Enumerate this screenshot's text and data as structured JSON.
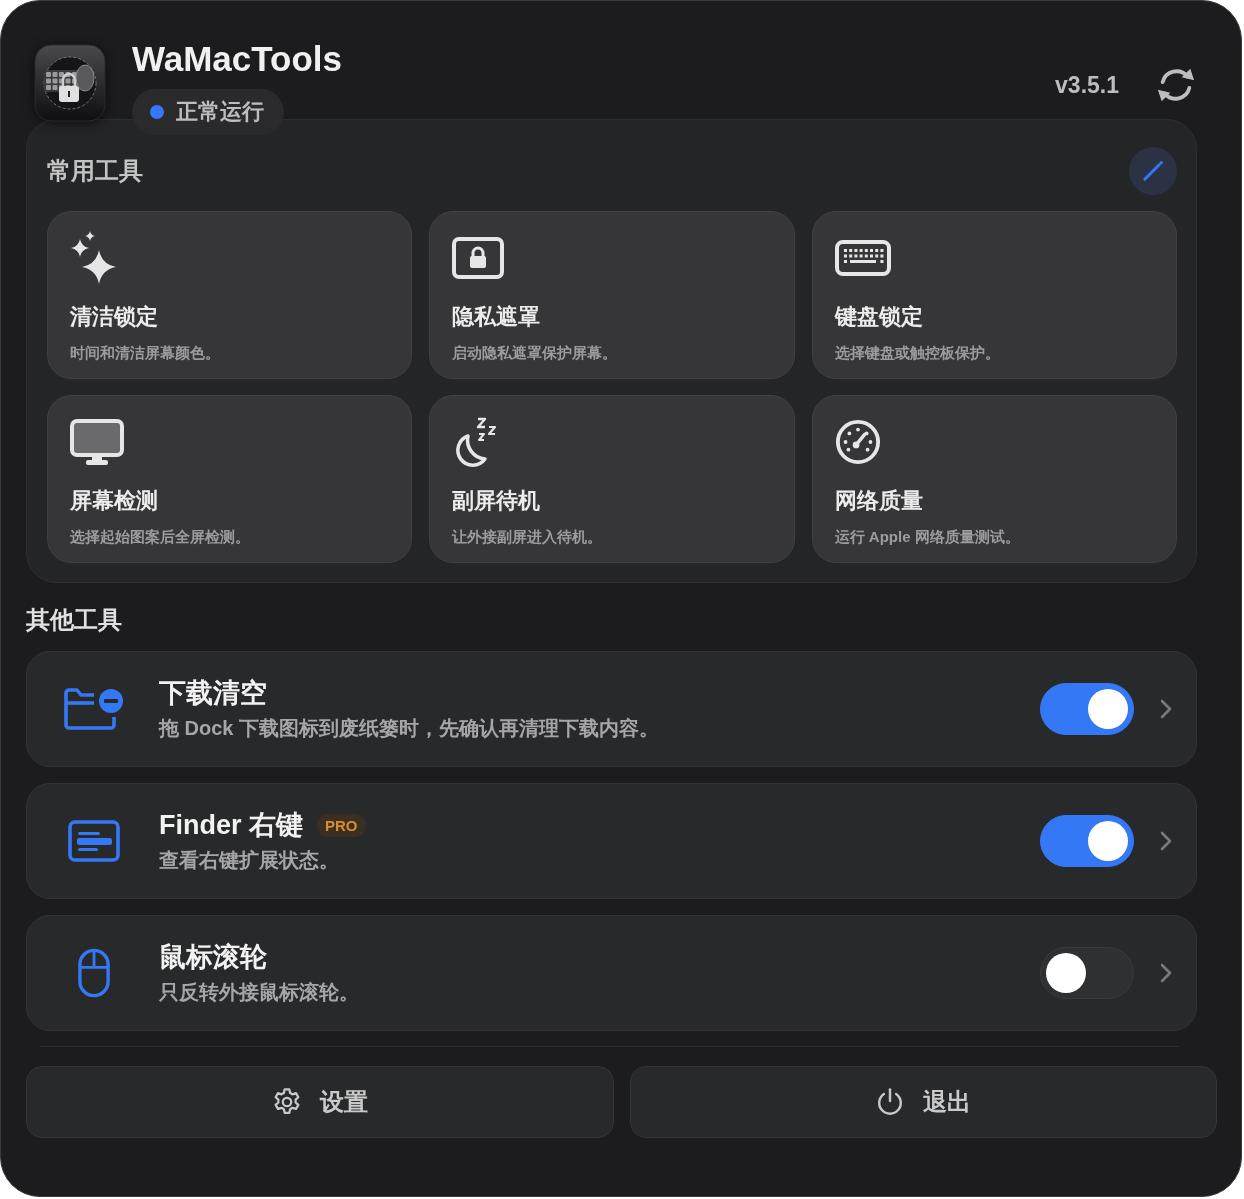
{
  "header": {
    "app_name": "WaMacTools",
    "status": "正常运行",
    "version": "v3.5.1"
  },
  "common_tools": {
    "title": "常用工具",
    "tools": [
      {
        "title": "清洁锁定",
        "description": "时间和清洁屏幕颜色。"
      },
      {
        "title": "隐私遮罩",
        "description": "启动隐私遮罩保护屏幕。"
      },
      {
        "title": "键盘锁定",
        "description": "选择键盘或触控板保护。"
      },
      {
        "title": "屏幕检测",
        "description": "选择起始图案后全屏检测。"
      },
      {
        "title": "副屏待机",
        "description": "让外接副屏进入待机。"
      },
      {
        "title": "网络质量",
        "description": "运行 Apple 网络质量测试。"
      }
    ]
  },
  "other_tools": {
    "title": "其他工具",
    "items": [
      {
        "title": "下载清空",
        "description": "拖 Dock 下载图标到废纸篓时，先确认再清理下载内容。",
        "on": true
      },
      {
        "title": "Finder 右键",
        "badge": "PRO",
        "description": "查看右键扩展状态。",
        "on": true
      },
      {
        "title": "鼠标滚轮",
        "description": "只反转外接鼠标滚轮。",
        "on": false
      }
    ]
  },
  "footer": {
    "buttons": [
      "设置",
      "退出"
    ]
  }
}
